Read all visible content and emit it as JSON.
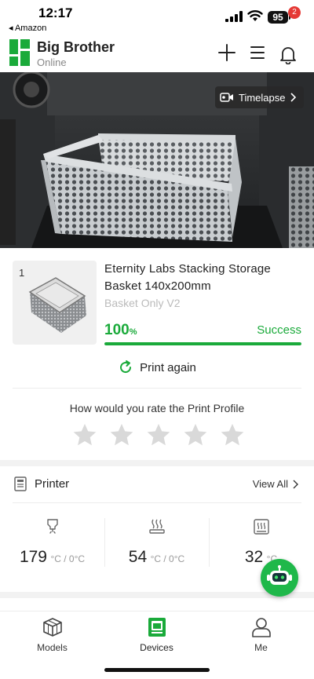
{
  "status_bar": {
    "time": "12:17",
    "back_app": "◂ Amazon",
    "battery": "95"
  },
  "header": {
    "device_name": "Big Brother",
    "device_status": "Online",
    "notification_count": "2",
    "accent_color": "#1aaa3a"
  },
  "camera": {
    "timelapse_label": "Timelapse"
  },
  "print_job": {
    "plate_number": "1",
    "model_name": "Eternity Labs Stacking Storage Basket 140x200mm",
    "plate_name": "Basket Only V2",
    "progress_value": "100",
    "progress_unit": "%",
    "progress_fraction": 1.0,
    "status": "Success",
    "print_again_label": "Print again"
  },
  "rating": {
    "prompt": "How would you rate the Print Profile",
    "max_stars": 5,
    "selected": 0
  },
  "printer": {
    "title": "Printer",
    "view_all": "View All",
    "temperatures": [
      {
        "icon": "nozzle-icon",
        "value": "179",
        "unit": "°C / 0°C"
      },
      {
        "icon": "heatbed-icon",
        "value": "54",
        "unit": "°C / 0°C"
      },
      {
        "icon": "chamber-icon",
        "value": "32",
        "unit": "°C"
      }
    ]
  },
  "tabs": [
    {
      "label": "Models",
      "icon": "cube-icon",
      "active": false
    },
    {
      "label": "Devices",
      "icon": "printer-icon",
      "active": true
    },
    {
      "label": "Me",
      "icon": "user-icon",
      "active": false
    }
  ]
}
